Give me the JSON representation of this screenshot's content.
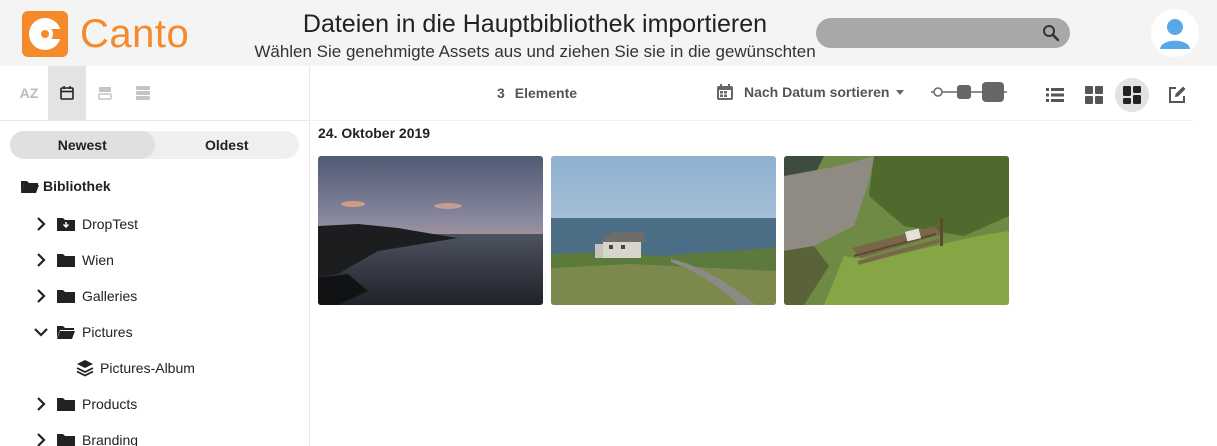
{
  "brand": {
    "name": "Canto",
    "color": "#f48a2a"
  },
  "header": {
    "title": "Dateien in die Hauptbibliothek importieren",
    "subtitle": "Wählen Sie genehmigte Assets aus und ziehen Sie sie in die gewünschten"
  },
  "search": {
    "placeholder": "",
    "icon": "search-icon"
  },
  "user": {
    "avatar": "user-avatar-icon"
  },
  "sidebar": {
    "view_buttons": [
      {
        "name": "alphabetical",
        "label": "AZ"
      },
      {
        "name": "date",
        "icon": "calendar-icon",
        "active": true
      },
      {
        "name": "compact",
        "icon": "rows-icon"
      },
      {
        "name": "list",
        "icon": "stack-icon"
      }
    ],
    "sort_toggle": {
      "newest": "Newest",
      "oldest": "Oldest",
      "selected": "Newest"
    },
    "tree": {
      "root": "Bibliothek",
      "items": [
        {
          "label": "DropTest",
          "expanded": false,
          "icon": "drop-folder-icon"
        },
        {
          "label": "Wien",
          "expanded": false,
          "icon": "folder-icon"
        },
        {
          "label": "Galleries",
          "expanded": false,
          "icon": "folder-icon"
        },
        {
          "label": "Pictures",
          "expanded": true,
          "icon": "folder-open-icon"
        },
        {
          "label": "Pictures-Album",
          "child": true,
          "icon": "album-layers-icon"
        },
        {
          "label": "Products",
          "expanded": false,
          "icon": "folder-icon"
        },
        {
          "label": "Branding",
          "expanded": false,
          "icon": "folder-icon"
        }
      ]
    }
  },
  "toolbar": {
    "count": "3",
    "count_label": "Elemente",
    "sort_label": "Nach Datum sortieren",
    "views": [
      "list-view-icon",
      "grid-view-icon",
      "mosaic-view-icon",
      "edit-icon"
    ],
    "active_view": "mosaic-view-icon"
  },
  "content": {
    "date_group": "24. Oktober 2019",
    "thumbnails": [
      "sunset-coast-thumbnail",
      "house-on-cliff-thumbnail",
      "grassy-cliff-fence-thumbnail"
    ]
  }
}
